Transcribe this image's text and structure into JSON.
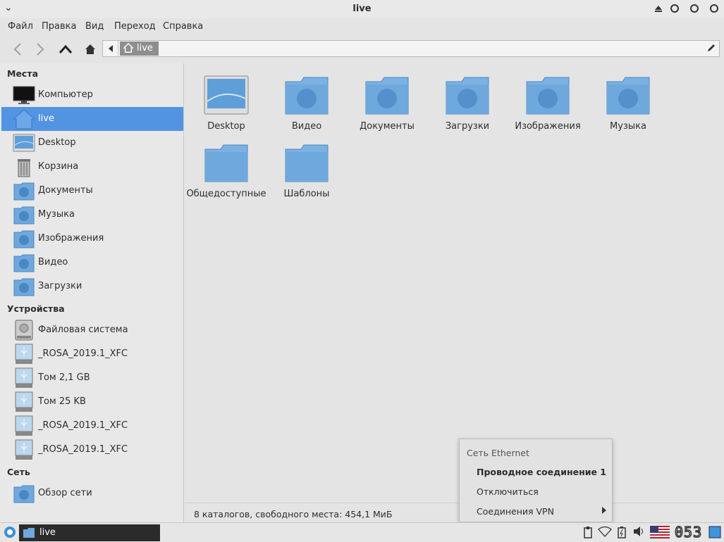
{
  "window": {
    "title": "live"
  },
  "menu": [
    "Файл",
    "Правка",
    "Вид",
    "Переход",
    "Справка"
  ],
  "toolbar": {
    "path_segment": "live"
  },
  "sidebar": {
    "sections": {
      "places": "Места",
      "devices": "Устройства",
      "network": "Сеть"
    },
    "places": [
      "Компьютер",
      "live",
      "Desktop",
      "Корзина",
      "Документы",
      "Музыка",
      "Изображения",
      "Видео",
      "Загрузки"
    ],
    "devices": [
      "Файловая система",
      "_ROSA_2019.1_XFC",
      "Том 2,1 GB",
      "Том 25 KB",
      "_ROSA_2019.1_XFC",
      "_ROSA_2019.1_XFC"
    ],
    "network": [
      "Обзор сети"
    ]
  },
  "content": {
    "items": [
      "Desktop",
      "Видео",
      "Документы",
      "Загрузки",
      "Изображения",
      "Музыка",
      "Общедоступные",
      "Шаблоны"
    ]
  },
  "status": {
    "text": "8 каталогов, свободного места: 454,1 МиБ"
  },
  "network_menu": {
    "header": "Сеть Ethernet",
    "items": [
      "Проводное соединение 1",
      "Отключиться",
      "Соединения VPN"
    ]
  },
  "panel": {
    "task_label": "live",
    "clock": "053"
  },
  "colors": {
    "accent": "#5294e2",
    "folder": "#6fa8dc",
    "task_bg": "#2b2b2b"
  }
}
